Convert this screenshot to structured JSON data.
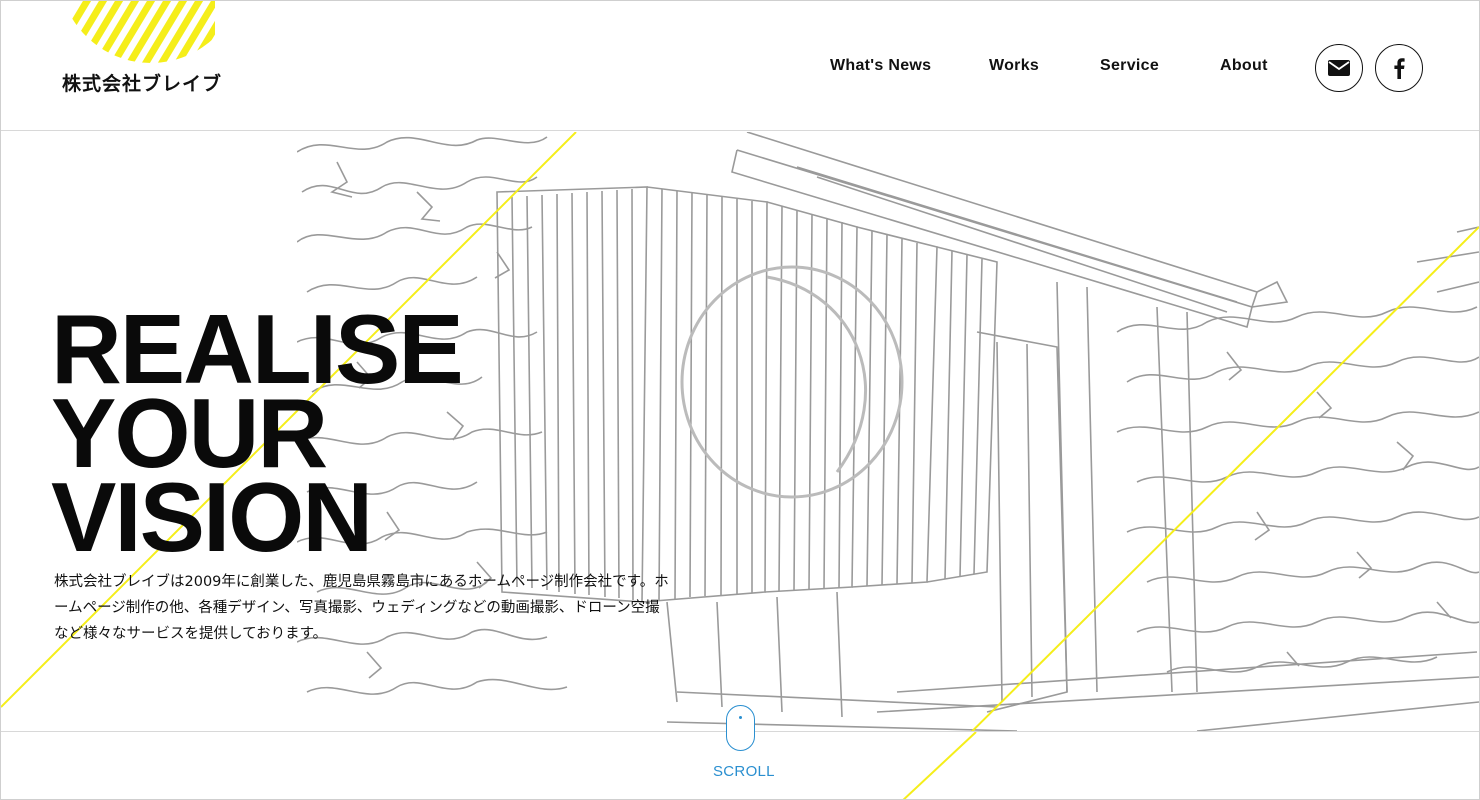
{
  "header": {
    "logo_text": "株式会社ブレイブ",
    "nav": [
      "What's News",
      "Works",
      "Service",
      "About"
    ],
    "mail_icon": "envelope-icon",
    "facebook_icon": "facebook-icon"
  },
  "hero": {
    "headline": [
      "REALISE",
      "YOUR",
      "VISION"
    ],
    "lead": "株式会社ブレイブは2009年に創業した、鹿児島県霧島市にあるホームページ制作会社です。ホームページ制作の他、各種デザイン、写真撮影、ウェディングなどの動画撮影、ドローン空撮など様々なサービスを提供しております。"
  },
  "scroll": {
    "label": "SCROLL"
  },
  "colors": {
    "accent_yellow": "#f5ee1a",
    "scroll_blue": "#2a8fd0",
    "line_gray": "#9a9a9a"
  }
}
